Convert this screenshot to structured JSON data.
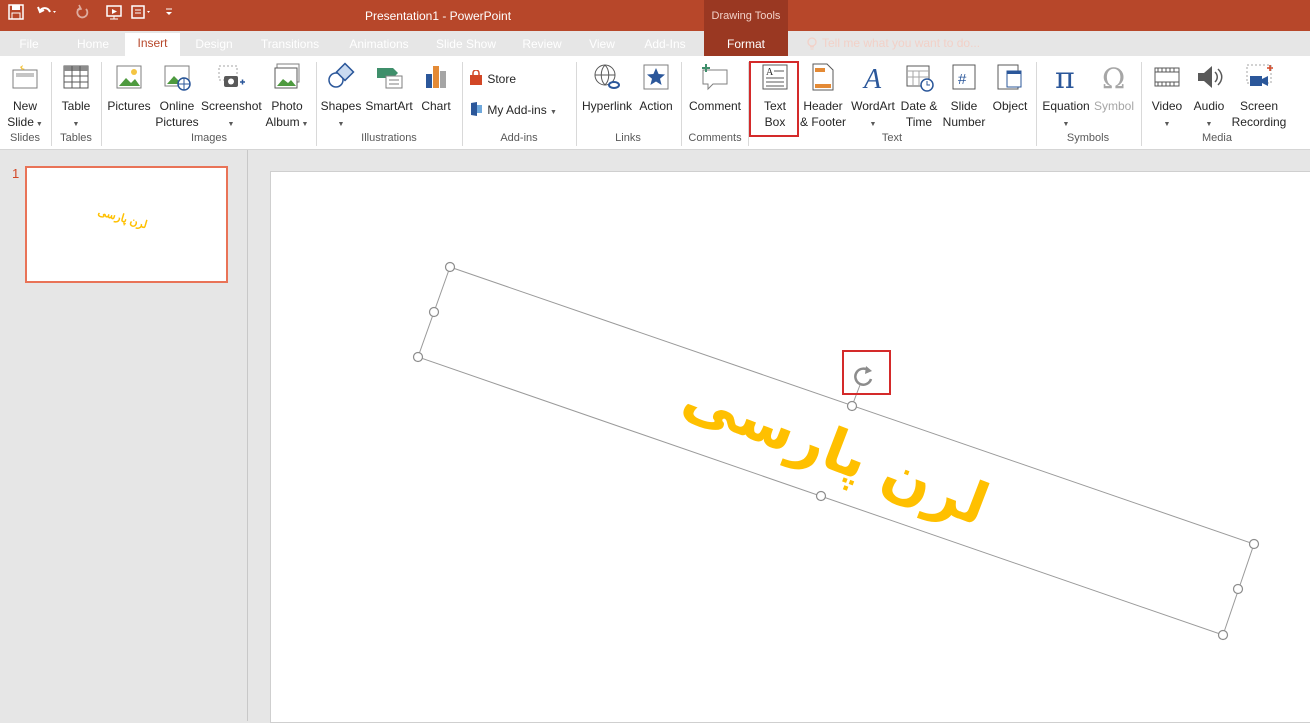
{
  "window": {
    "title": "Presentation1 - PowerPoint",
    "context_group": "Drawing Tools"
  },
  "tabs": [
    {
      "label": "File"
    },
    {
      "label": "Home"
    },
    {
      "label": "Insert",
      "active": true
    },
    {
      "label": "Design"
    },
    {
      "label": "Transitions"
    },
    {
      "label": "Animations"
    },
    {
      "label": "Slide Show"
    },
    {
      "label": "Review"
    },
    {
      "label": "View"
    },
    {
      "label": "Add-Ins"
    },
    {
      "label": "Format"
    }
  ],
  "tell_me": "Tell me what you want to do...",
  "ribbon": {
    "slides": {
      "label": "Slides",
      "new_slide_1": "New",
      "new_slide_2": "Slide"
    },
    "tables": {
      "label": "Tables",
      "table": "Table"
    },
    "images": {
      "label": "Images",
      "pictures": "Pictures",
      "online_1": "Online",
      "online_2": "Pictures",
      "screenshot": "Screenshot",
      "photo_1": "Photo",
      "photo_2": "Album"
    },
    "illustrations": {
      "label": "Illustrations",
      "shapes": "Shapes",
      "smartart": "SmartArt",
      "chart": "Chart"
    },
    "addins": {
      "label": "Add-ins",
      "store": "Store",
      "my_addins": "My Add-ins"
    },
    "links": {
      "label": "Links",
      "hyperlink": "Hyperlink",
      "action": "Action"
    },
    "comments": {
      "label": "Comments",
      "comment": "Comment"
    },
    "text": {
      "label": "Text",
      "textbox_1": "Text",
      "textbox_2": "Box",
      "header_1": "Header",
      "header_2": "& Footer",
      "wordart": "WordArt",
      "date_1": "Date &",
      "date_2": "Time",
      "slidenum_1": "Slide",
      "slidenum_2": "Number",
      "object": "Object"
    },
    "symbols": {
      "label": "Symbols",
      "equation": "Equation",
      "symbol": "Symbol"
    },
    "media": {
      "label": "Media",
      "video": "Video",
      "audio": "Audio",
      "screen_1": "Screen",
      "screen_2": "Recording"
    }
  },
  "thumbnails": [
    {
      "number": "1",
      "text": "لرن پارسی"
    }
  ],
  "slide": {
    "text": "لرن پارسی"
  },
  "colors": {
    "accent": "#b7472a",
    "title_text": "#ffc000",
    "highlight": "#d42a2a"
  }
}
